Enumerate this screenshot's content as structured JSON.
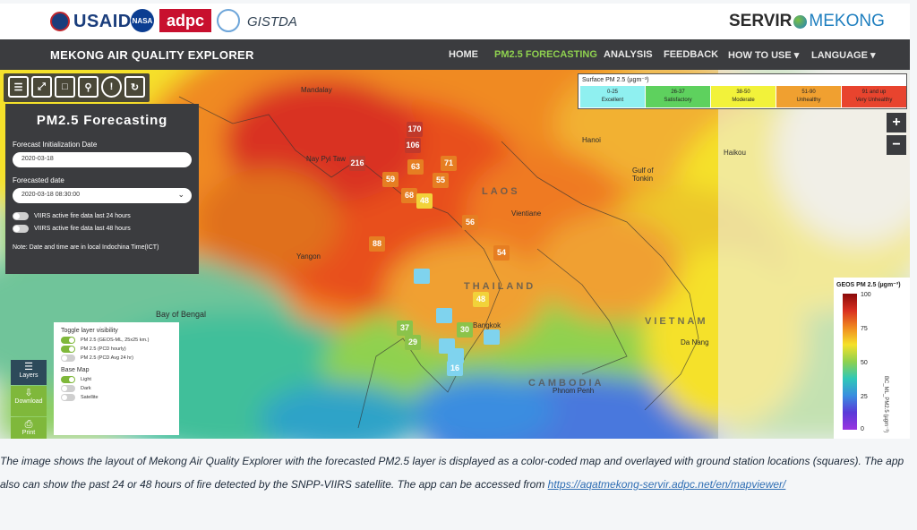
{
  "logos": {
    "usaid": "USAID",
    "nasa": "NASA",
    "adpc": "adpc",
    "gistda": "GISTDA",
    "servir": "SERVIR",
    "servir_suffix": "MEKONG"
  },
  "nav": {
    "title": "MEKONG AIR QUALITY EXPLORER",
    "items": [
      {
        "label": "HOME"
      },
      {
        "label": "PM2.5 FORECASTING"
      },
      {
        "label": "ANALYSIS"
      },
      {
        "label": "FEEDBACK"
      },
      {
        "label": "HOW TO USE ▾"
      },
      {
        "label": "LANGUAGE ▾"
      }
    ],
    "active_color": "#8fd14f"
  },
  "toolbar": {
    "tools": [
      "layers-icon",
      "fullscreen-icon",
      "select-area-icon",
      "location-pin-icon",
      "info-icon",
      "refresh-icon"
    ]
  },
  "forecast": {
    "title": "PM2.5 Forecasting",
    "init_label": "Forecast Initialization Date",
    "init_value": "2020-03-18",
    "date_label": "Forecasted date",
    "date_value": "2020-03-18 08:30:00",
    "fire24": "VIIRS active fire data last 24 hours",
    "fire48": "VIIRS active fire data last 48 hours",
    "note": "Note: Date and time are in local Indochina Time(ICT)"
  },
  "aqi_legend": {
    "title": "Surface PM 2.5 (µgm⁻³)",
    "categories": [
      {
        "range": "0-25",
        "label": "Excellent",
        "color": "#8ff0f0"
      },
      {
        "range": "26-37",
        "label": "Satisfactory",
        "color": "#5ed15e"
      },
      {
        "range": "38-50",
        "label": "Moderate",
        "color": "#f2f23a"
      },
      {
        "range": "51-90",
        "label": "Unhealthy",
        "color": "#f0a030"
      },
      {
        "range": "91 and up",
        "label": "Very Unhealthy",
        "color": "#e8442e"
      }
    ]
  },
  "zoom": {
    "in": "+",
    "out": "−"
  },
  "geos_legend": {
    "title": "GEOS PM 2.5",
    "unit": "(µgm⁻³)",
    "axis": "BC_ML_PM2.5 (µgm⁻³)",
    "ticks": [
      "100",
      "75",
      "50",
      "25",
      "0"
    ]
  },
  "layers_panel": {
    "title": "Toggle layer visibility",
    "layers": [
      {
        "label": "PM 2.5 (GEOS-ML, 25x25 km.)",
        "on": true
      },
      {
        "label": "PM 2.5 (PCD hourly)",
        "on": true
      },
      {
        "label": "PM 2.5 (PCD Avg 24 hr)",
        "on": false
      }
    ],
    "basemap_title": "Base Map",
    "basemaps": [
      {
        "label": "Light",
        "on": true
      },
      {
        "label": "Dark",
        "on": false
      },
      {
        "label": "Satellite",
        "on": false
      }
    ]
  },
  "side_buttons": [
    {
      "label": "Layers",
      "icon": "stack-icon",
      "color": "#2d4a5a"
    },
    {
      "label": "Download",
      "icon": "download-icon",
      "color": "#7fb83b"
    },
    {
      "label": "Print",
      "icon": "print-icon",
      "color": "#7fb83b"
    }
  ],
  "map_labels": {
    "cities": [
      "Mandalay",
      "Nay Pyi Taw",
      "Yangon",
      "Bay of Bengal",
      "Hanoi",
      "Haikou",
      "Gulf of Tonkin",
      "Vientiane",
      "Bangkok",
      "Phnom Penh",
      "Da Nang"
    ],
    "countries": [
      "LAOS",
      "THAILAND",
      "VIETNAM",
      "CAMBODIA"
    ]
  },
  "stations": [
    {
      "value": "170",
      "color": "#c0392b"
    },
    {
      "value": "106",
      "color": "#c0392b"
    },
    {
      "value": "216",
      "color": "#c0392b"
    },
    {
      "value": "63",
      "color": "#e67e22"
    },
    {
      "value": "71",
      "color": "#e67e22"
    },
    {
      "value": "59",
      "color": "#e67e22"
    },
    {
      "value": "55",
      "color": "#e67e22"
    },
    {
      "value": "68",
      "color": "#e67e22"
    },
    {
      "value": "48",
      "color": "#f2d23a"
    },
    {
      "value": "56",
      "color": "#e67e22"
    },
    {
      "value": "88",
      "color": "#e67e22"
    },
    {
      "value": "54",
      "color": "#e67e22"
    },
    {
      "value": "48",
      "color": "#f2d23a"
    },
    {
      "value": "37",
      "color": "#8bc34a"
    },
    {
      "value": "29",
      "color": "#8bc34a"
    },
    {
      "value": "30",
      "color": "#8bc34a"
    },
    {
      "value": "16",
      "color": "#7fd3ee"
    }
  ],
  "caption": {
    "text": "The image shows the layout of Mekong Air Quality Explorer with the forecasted PM2.5 layer is displayed as a color-coded map and overlayed with ground station locations (squares). The app also can show the past 24 or 48 hours of fire detected by the SNPP-VIIRS satellite. The app can be accessed from ",
    "link": "https://aqatmekong-servir.adpc.net/en/mapviewer/"
  }
}
